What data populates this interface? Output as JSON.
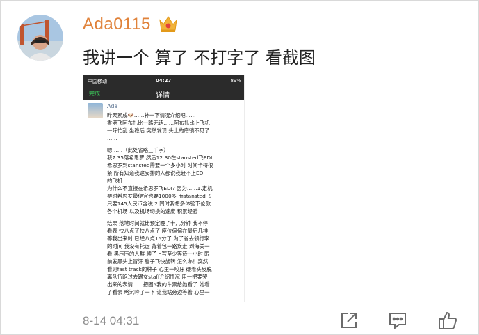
{
  "comment": {
    "username": "Ada0115",
    "text": "我讲一个 算了 不打字了 看截图",
    "timestamp": "8-14 04:31"
  },
  "screenshot": {
    "status": {
      "carrier": "中国移动",
      "time": "04:27",
      "battery": "89%"
    },
    "nav": {
      "done": "完成",
      "title": "详情"
    },
    "author": "Ada",
    "lines": [
      "昨天累成🐶……补一下情况介绍吧……",
      "香港飞阿布扎比一路无话……阿布扎比上飞机",
      "一阵忙乱 坐稳后 突然发现 头上的磨镜不见了",
      "……",
      "嗯……（此处省略三千字）",
      "我7:35落希思罗 然后12:30在stansted飞EDI",
      "希思罗到stansted需要一个多小时 时间卡得很",
      "紧 所有知道我这安排的人都说我赶不上EDI",
      "的飞机",
      "为什么不直接在希思罗飞EDI? 因为……1.定机",
      "票时希思罗最便宜也要1000多 而stansted飞",
      "只要145人民币含税 2.同时我想多体验下伦敦",
      "各个机场 以及机场切换的速度 积累经验",
      "结果 落地时间就比预定晚了十几分钟 我不停",
      "看表 快八点了快八点了 座位偏偏在最后几排",
      "等我出来时 已经八点15分了 为了省去领行李",
      "的时间 我没有托运 背着包一路疾走 到海关一",
      "看 黑压压的人群 牌子上写至少等待一小时 眼",
      "前发黑头上冒汗 脑子飞快旋转 怎么办！突然",
      "看见fast track的牌子 心里一咬牙 硬着头皮脱",
      "离队伍跑过去跟女staff介绍情况 用一把要哭",
      "出来的表情……把图5我的车票给她看了 她看",
      "了看表 略沉吟了一下 让我站旁边等着 心里一"
    ]
  },
  "actions": [
    "share-icon",
    "comment-icon",
    "like-icon"
  ]
}
